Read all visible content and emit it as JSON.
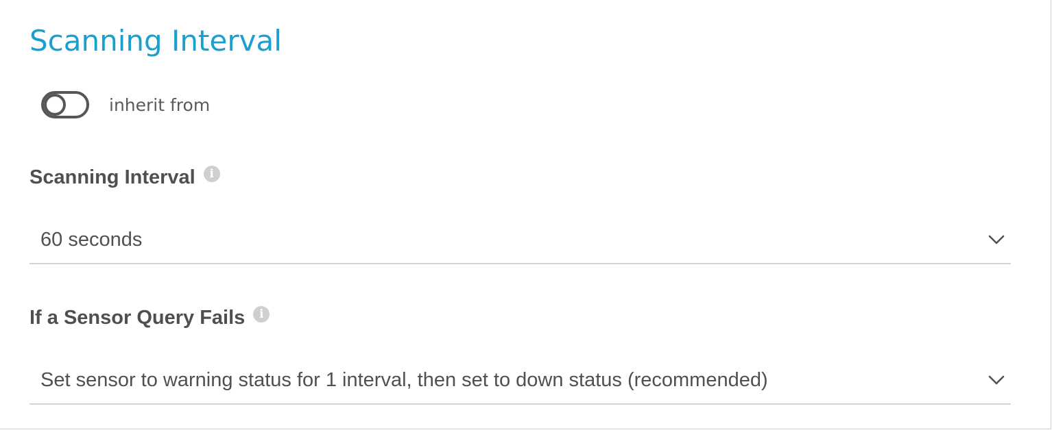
{
  "section": {
    "title": "Scanning Interval"
  },
  "inherit": {
    "label": "inherit from",
    "enabled": false
  },
  "scanning_interval": {
    "label": "Scanning Interval",
    "info_icon": "info-icon",
    "selected": "60 seconds",
    "dropdown_icon": "chevron-down-icon"
  },
  "query_failure": {
    "label": "If a Sensor Query Fails",
    "info_icon": "info-icon",
    "selected": "Set sensor to warning status for 1 interval, then set to down status (recommended)",
    "dropdown_icon": "chevron-down-icon"
  },
  "colors": {
    "title": "#1a9fd1",
    "text": "#505050",
    "toggle": "#565656",
    "info_icon": "#cfcfcf",
    "underline": "#d4d4d4"
  }
}
